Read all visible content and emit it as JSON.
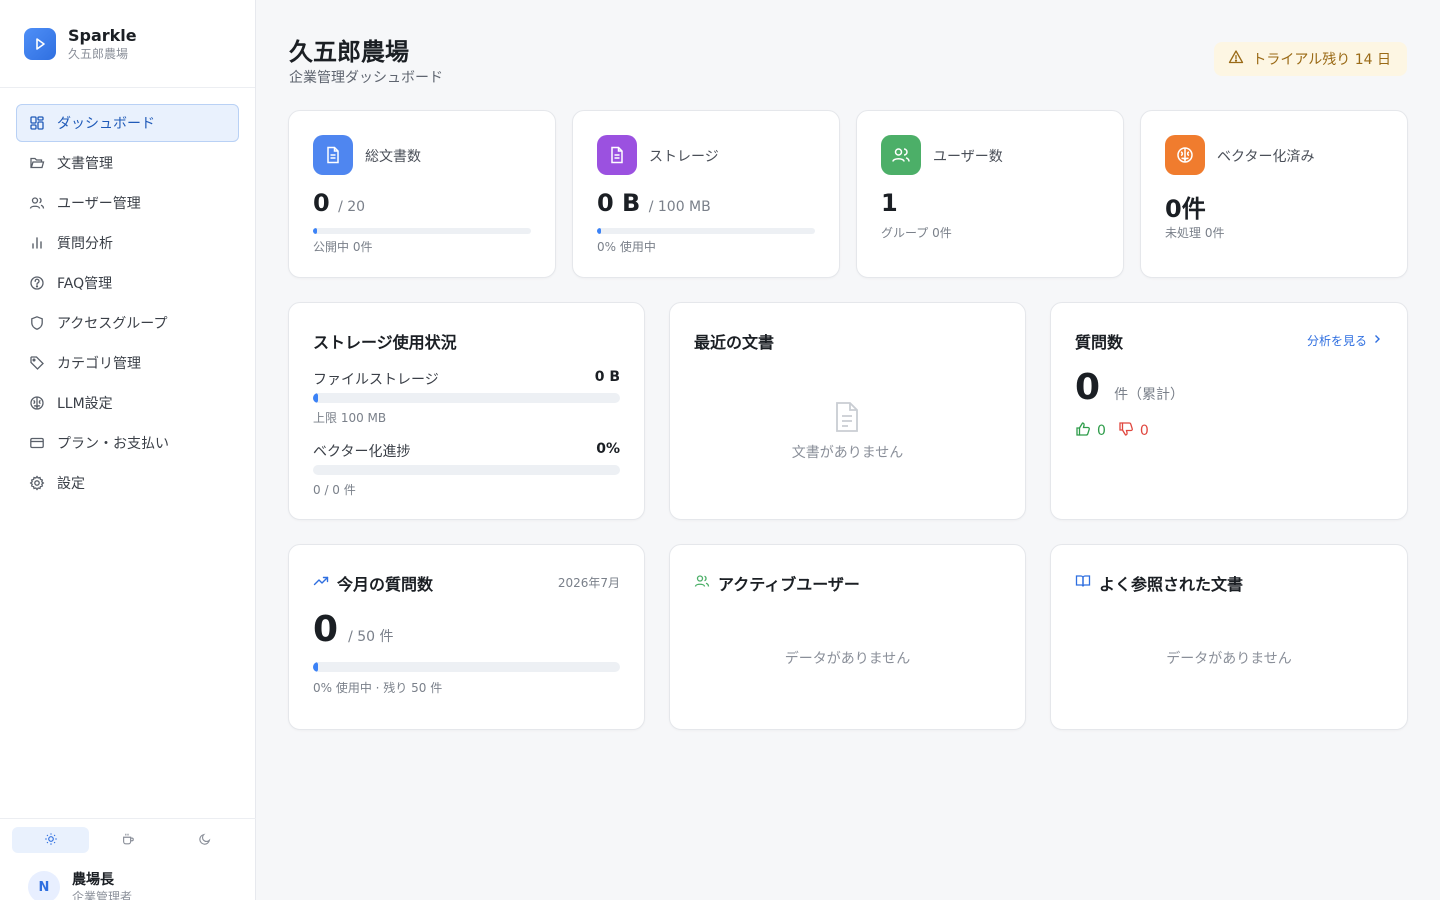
{
  "brand": {
    "name": "Sparkle",
    "org": "久五郎農場"
  },
  "nav": [
    {
      "label": "ダッシュボード",
      "icon": "dashboard-icon",
      "active": true
    },
    {
      "label": "文書管理",
      "icon": "folder-icon"
    },
    {
      "label": "ユーザー管理",
      "icon": "users-icon"
    },
    {
      "label": "質問分析",
      "icon": "bar-chart-icon"
    },
    {
      "label": "FAQ管理",
      "icon": "help-circle-icon"
    },
    {
      "label": "アクセスグループ",
      "icon": "shield-icon"
    },
    {
      "label": "カテゴリ管理",
      "icon": "tag-icon"
    },
    {
      "label": "LLM設定",
      "icon": "brain-icon"
    },
    {
      "label": "プラン・お支払い",
      "icon": "credit-card-icon"
    },
    {
      "label": "設定",
      "icon": "gear-icon"
    }
  ],
  "theme": {
    "options": [
      "light",
      "coffee",
      "dark"
    ],
    "selected": "light"
  },
  "user": {
    "initial": "N",
    "name": "農場長",
    "role": "企業管理者"
  },
  "header": {
    "title": "久五郎農場",
    "subtitle": "企業管理ダッシュボード",
    "trial": "トライアル残り 14 日"
  },
  "colors": {
    "accent": "#3b82f6",
    "blue": "#3b82f6",
    "purple": "#9b51e0",
    "green": "#4caf68",
    "orange": "#f07c2e",
    "like": "#2e9c4a",
    "dislike": "#e0463e"
  },
  "stats": {
    "documents": {
      "label": "総文書数",
      "value": "0",
      "limit": "/ 20",
      "fill": 0,
      "note": "公開中 0件",
      "icon": "document-icon"
    },
    "storage": {
      "label": "ストレージ",
      "value": "0 B",
      "limit": "/ 100 MB",
      "fill": 0,
      "note": "0% 使用中",
      "icon": "document-icon"
    },
    "users": {
      "label": "ユーザー数",
      "value": "1",
      "note": "グループ 0件",
      "icon": "users-icon"
    },
    "vectorized": {
      "label": "ベクター化済み",
      "value": "0件",
      "note": "未処理 0件",
      "icon": "brain-icon"
    }
  },
  "storage_usage": {
    "title": "ストレージ使用状況",
    "file_label": "ファイルストレージ",
    "file_value": "0 B",
    "file_fill": 0,
    "file_limit": "上限 100 MB",
    "vector_label": "ベクター化進捗",
    "vector_value": "0%",
    "vector_fill": 0,
    "vector_count": "0 / 0 件"
  },
  "recent_docs": {
    "title": "最近の文書",
    "empty": "文書がありません"
  },
  "questions": {
    "title": "質問数",
    "link": "分析を見る",
    "value": "0",
    "unit": "件（累計）",
    "likes": "0",
    "dislikes": "0"
  },
  "monthly": {
    "title": "今月の質問数",
    "month": "2026年7月",
    "value": "0",
    "limit": "/ 50 件",
    "fill": 0,
    "note": "0% 使用中 · 残り 50 件"
  },
  "active_users": {
    "title": "アクティブユーザー",
    "empty": "データがありません"
  },
  "top_docs": {
    "title": "よく参照された文書",
    "empty": "データがありません"
  }
}
